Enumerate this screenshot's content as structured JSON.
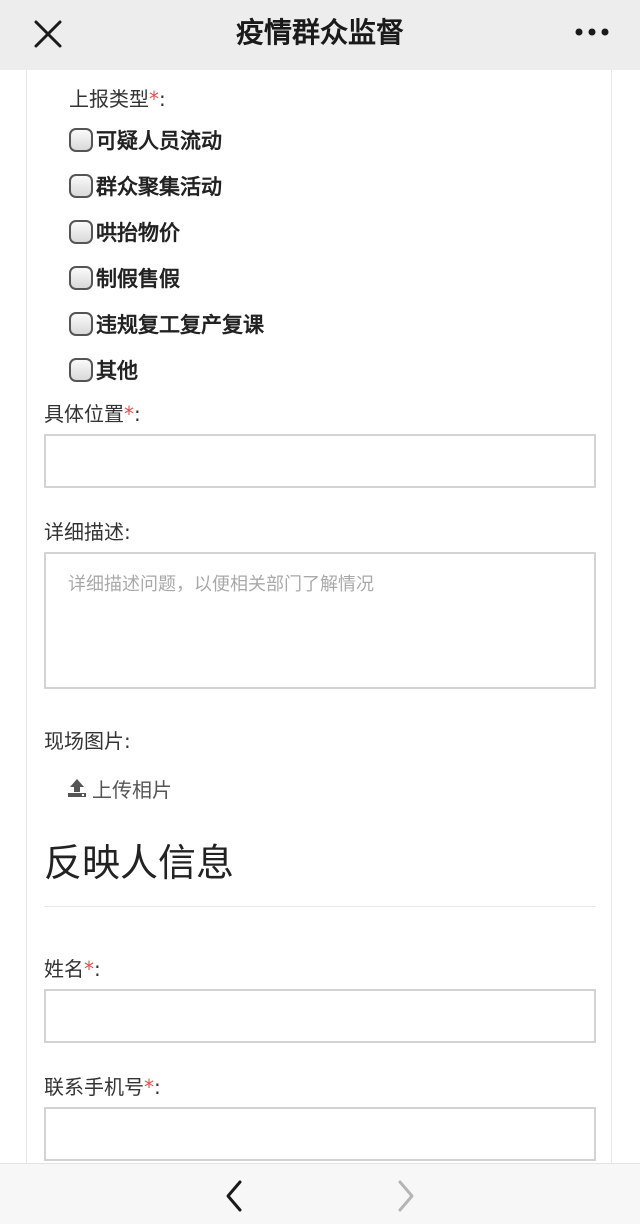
{
  "header": {
    "title": "疫情群众监督",
    "close_icon": "close-icon",
    "more_icon": "more-dots-icon"
  },
  "form": {
    "report_type": {
      "label": "上报类型",
      "required_mark": "*",
      "suffix": ":",
      "options": [
        {
          "label": "可疑人员流动",
          "checked": false
        },
        {
          "label": "群众聚集活动",
          "checked": false
        },
        {
          "label": "哄抬物价",
          "checked": false
        },
        {
          "label": "制假售假",
          "checked": false
        },
        {
          "label": "违规复工复产复课",
          "checked": false
        },
        {
          "label": "其他",
          "checked": false
        }
      ]
    },
    "location": {
      "label": "具体位置",
      "required_mark": "*",
      "suffix": ":",
      "value": ""
    },
    "description": {
      "label": "详细描述:",
      "placeholder": "详细描述问题，以便相关部门了解情况",
      "value": ""
    },
    "photos": {
      "label": "现场图片:",
      "upload_label": "上传相片",
      "upload_icon": "upload-icon"
    },
    "reporter_section": {
      "title": "反映人信息"
    },
    "name": {
      "label": "姓名",
      "required_mark": "*",
      "suffix": ":",
      "value": ""
    },
    "phone": {
      "label": "联系手机号",
      "required_mark": "*",
      "suffix": ":",
      "value": ""
    }
  },
  "bottom_nav": {
    "back_icon": "chevron-left-icon",
    "forward_icon": "chevron-right-icon",
    "forward_enabled": false
  },
  "colors": {
    "required": "#d9534f",
    "topbar": "#ededed",
    "border": "#d3d3d3"
  }
}
